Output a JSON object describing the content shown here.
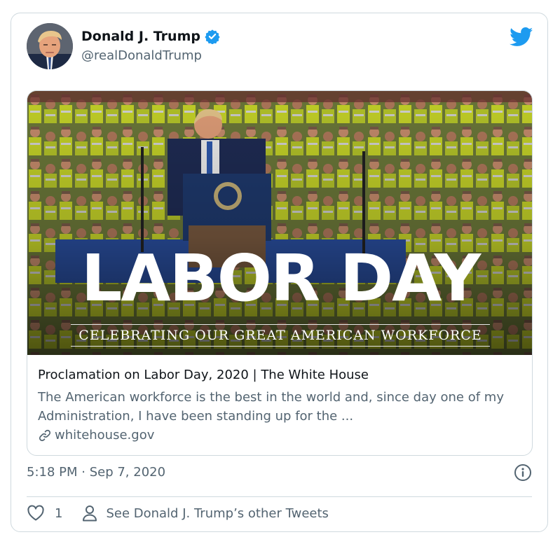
{
  "author": {
    "name": "Donald J. Trump",
    "handle": "@realDonaldTrump",
    "verified": true
  },
  "icons": {
    "brand": "twitter-bird-icon",
    "verified": "verified-badge-icon",
    "link": "link-icon",
    "info": "info-icon",
    "like": "heart-icon",
    "profile": "person-icon"
  },
  "colors": {
    "twitter_blue": "#1d9bf0",
    "secondary_text": "#536471",
    "border": "#cfd9de"
  },
  "card": {
    "image": {
      "headline": "LABOR DAY",
      "subheadline": "CELEBRATING OUR GREAT AMERICAN WORKFORCE"
    },
    "title": "Proclamation on Labor Day, 2020 | The White House",
    "description": "The American workforce is the best in the world and, since day one of my Administration, I have been standing up for the ...",
    "domain": "whitehouse.gov"
  },
  "timestamp": "5:18 PM · Sep 7, 2020",
  "actions": {
    "like_count": "1",
    "profile_link": "See Donald J. Trump’s other Tweets"
  }
}
